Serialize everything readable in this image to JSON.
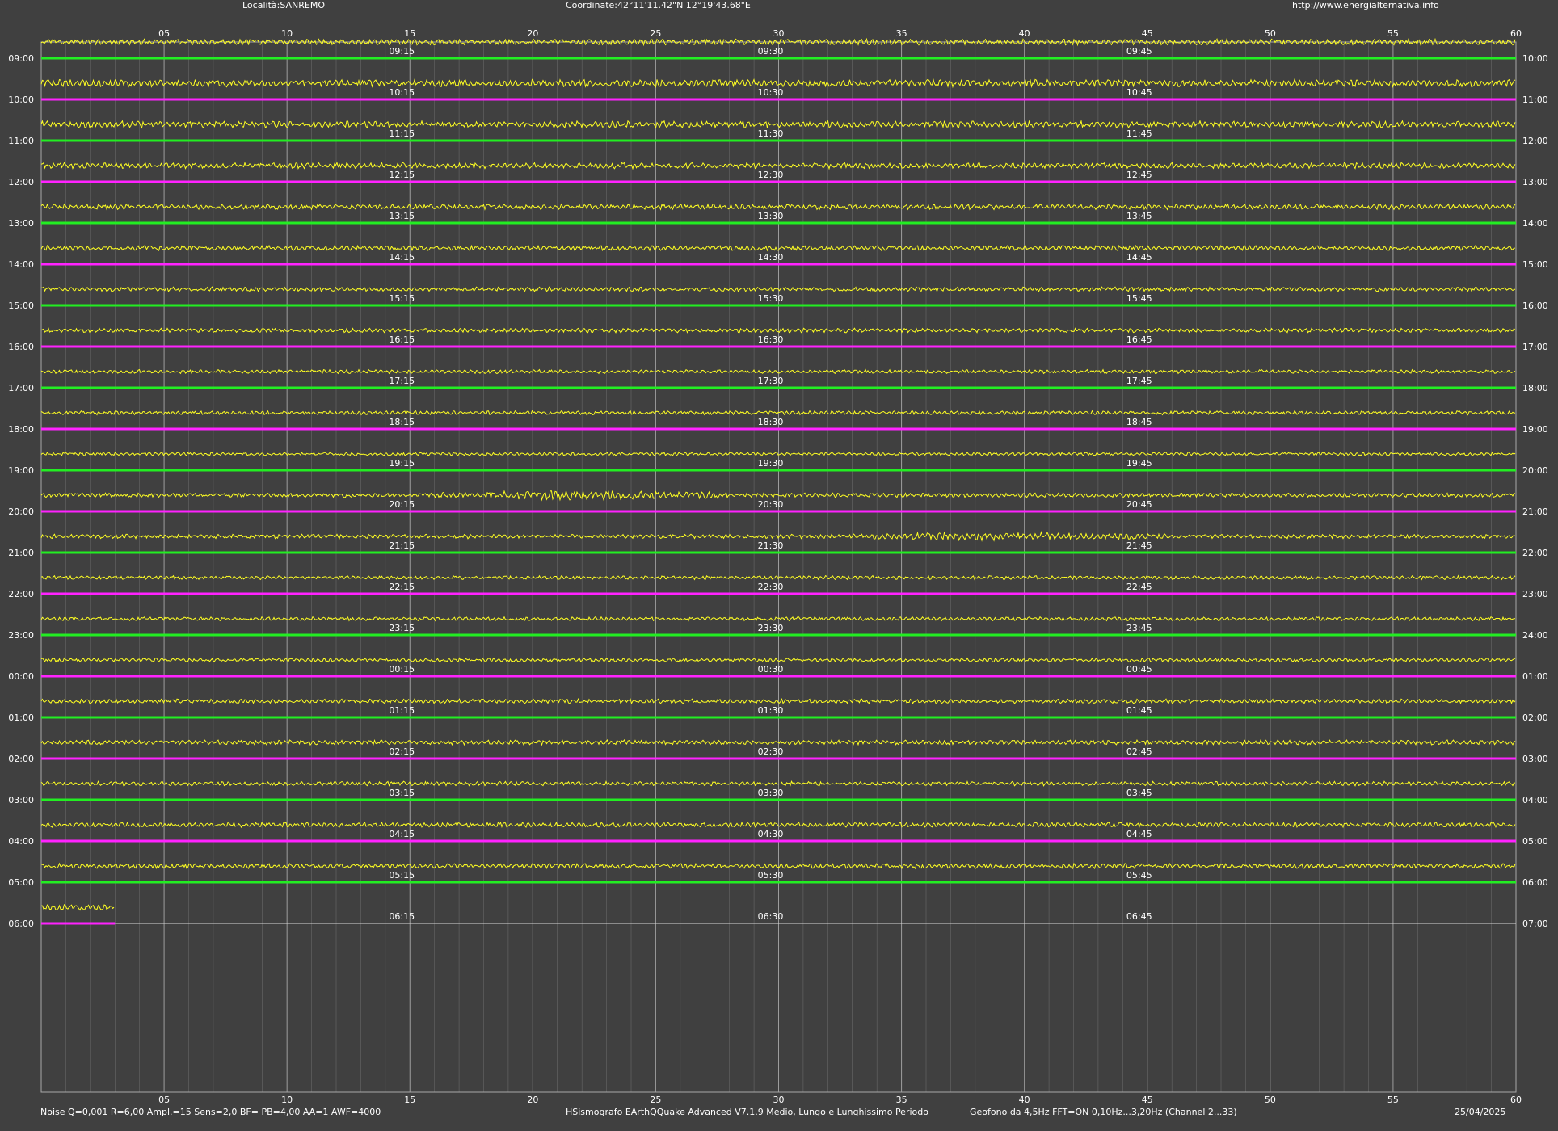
{
  "header": {
    "location": "Località:SANREMO",
    "coordinates": "Coordinate:42°11'11.42\"N  12°19'43.68\"E",
    "website": "http://www.energialternativa.info"
  },
  "footer": {
    "settings": "Noise Q=0,001 R=6,00 Ampl.=15 Sens=2,0 BF= PB=4,00 AA=1 AWF=4000",
    "software": "HSismografo  EArthQQuake Advanced V7.1.9  Medio, Lungo e Lunghissimo Periodo",
    "geophone": "Geofono da 4,5Hz FFT=ON 0,10Hz...3,20Hz      (Channel 2...33)",
    "date": "25/04/2025"
  },
  "chart_data": {
    "type": "helicorder",
    "x_axis": {
      "min": 0,
      "max": 60,
      "unit": "minutes",
      "tick_labels": [
        "05",
        "10",
        "15",
        "20",
        "25",
        "30",
        "35",
        "40",
        "45",
        "50",
        "55",
        "60"
      ]
    },
    "rows": [
      {
        "left": "09:00",
        "right": "10:00",
        "marks": [
          "09:15",
          "09:30",
          "09:45"
        ],
        "color": "#22ee22",
        "amp": 0.6,
        "events": []
      },
      {
        "left": "10:00",
        "right": "11:00",
        "marks": [
          "10:15",
          "10:30",
          "10:45"
        ],
        "color": "#ff22ff",
        "amp": 0.75,
        "events": []
      },
      {
        "left": "11:00",
        "right": "12:00",
        "marks": [
          "11:15",
          "11:30",
          "11:45"
        ],
        "color": "#22ee22",
        "amp": 0.7,
        "events": []
      },
      {
        "left": "12:00",
        "right": "13:00",
        "marks": [
          "12:15",
          "12:30",
          "12:45"
        ],
        "color": "#ff22ff",
        "amp": 0.6,
        "events": []
      },
      {
        "left": "13:00",
        "right": "14:00",
        "marks": [
          "13:15",
          "13:30",
          "13:45"
        ],
        "color": "#22ee22",
        "amp": 0.55,
        "events": []
      },
      {
        "left": "14:00",
        "right": "15:00",
        "marks": [
          "14:15",
          "14:30",
          "14:45"
        ],
        "color": "#ff22ff",
        "amp": 0.5,
        "events": []
      },
      {
        "left": "15:00",
        "right": "16:00",
        "marks": [
          "15:15",
          "15:30",
          "15:45"
        ],
        "color": "#22ee22",
        "amp": 0.45,
        "events": []
      },
      {
        "left": "16:00",
        "right": "17:00",
        "marks": [
          "16:15",
          "16:30",
          "16:45"
        ],
        "color": "#ff22ff",
        "amp": 0.45,
        "events": []
      },
      {
        "left": "17:00",
        "right": "18:00",
        "marks": [
          "17:15",
          "17:30",
          "17:45"
        ],
        "color": "#22ee22",
        "amp": 0.4,
        "events": []
      },
      {
        "left": "18:00",
        "right": "19:00",
        "marks": [
          "18:15",
          "18:30",
          "18:45"
        ],
        "color": "#ff22ff",
        "amp": 0.4,
        "events": []
      },
      {
        "left": "19:00",
        "right": "20:00",
        "marks": [
          "19:15",
          "19:30",
          "19:45"
        ],
        "color": "#22ee22",
        "amp": 0.35,
        "events": []
      },
      {
        "left": "20:00",
        "right": "21:00",
        "marks": [
          "20:15",
          "20:30",
          "20:45"
        ],
        "color": "#ff22ff",
        "amp": 0.45,
        "events": [
          [
            16,
            28,
            2.2
          ]
        ]
      },
      {
        "left": "21:00",
        "right": "22:00",
        "marks": [
          "21:15",
          "21:30",
          "21:45"
        ],
        "color": "#22ee22",
        "amp": 0.45,
        "events": [
          [
            33,
            46,
            1.8
          ]
        ]
      },
      {
        "left": "22:00",
        "right": "23:00",
        "marks": [
          "22:15",
          "22:30",
          "22:45"
        ],
        "color": "#ff22ff",
        "amp": 0.4,
        "events": []
      },
      {
        "left": "23:00",
        "right": "24:00",
        "marks": [
          "23:15",
          "23:30",
          "23:45"
        ],
        "color": "#22ee22",
        "amp": 0.4,
        "events": []
      },
      {
        "left": "00:00",
        "right": "01:00",
        "marks": [
          "00:15",
          "00:30",
          "00:45"
        ],
        "color": "#ff22ff",
        "amp": 0.4,
        "events": []
      },
      {
        "left": "01:00",
        "right": "02:00",
        "marks": [
          "01:15",
          "01:30",
          "01:45"
        ],
        "color": "#22ee22",
        "amp": 0.45,
        "events": []
      },
      {
        "left": "02:00",
        "right": "03:00",
        "marks": [
          "02:15",
          "02:30",
          "02:45"
        ],
        "color": "#ff22ff",
        "amp": 0.5,
        "events": []
      },
      {
        "left": "03:00",
        "right": "04:00",
        "marks": [
          "03:15",
          "03:30",
          "03:45"
        ],
        "color": "#22ee22",
        "amp": 0.45,
        "events": []
      },
      {
        "left": "04:00",
        "right": "05:00",
        "marks": [
          "04:15",
          "04:30",
          "04:45"
        ],
        "color": "#ff22ff",
        "amp": 0.5,
        "events": []
      },
      {
        "left": "05:00",
        "right": "06:00",
        "marks": [
          "05:15",
          "05:30",
          "05:45"
        ],
        "color": "#22ee22",
        "amp": 0.5,
        "events": []
      },
      {
        "left": "06:00",
        "right": "07:00",
        "marks": [
          "06:15",
          "06:30",
          "06:45"
        ],
        "color": "#ff22ff",
        "amp": 0.6,
        "events": [],
        "partial_minutes": 3
      }
    ],
    "colors": {
      "background": "#404040",
      "trace": "#ffff22",
      "grid": "#a8a8a8",
      "baseline_a": "#22ee22",
      "baseline_b": "#ff22ff",
      "text": "#ffffff"
    }
  }
}
